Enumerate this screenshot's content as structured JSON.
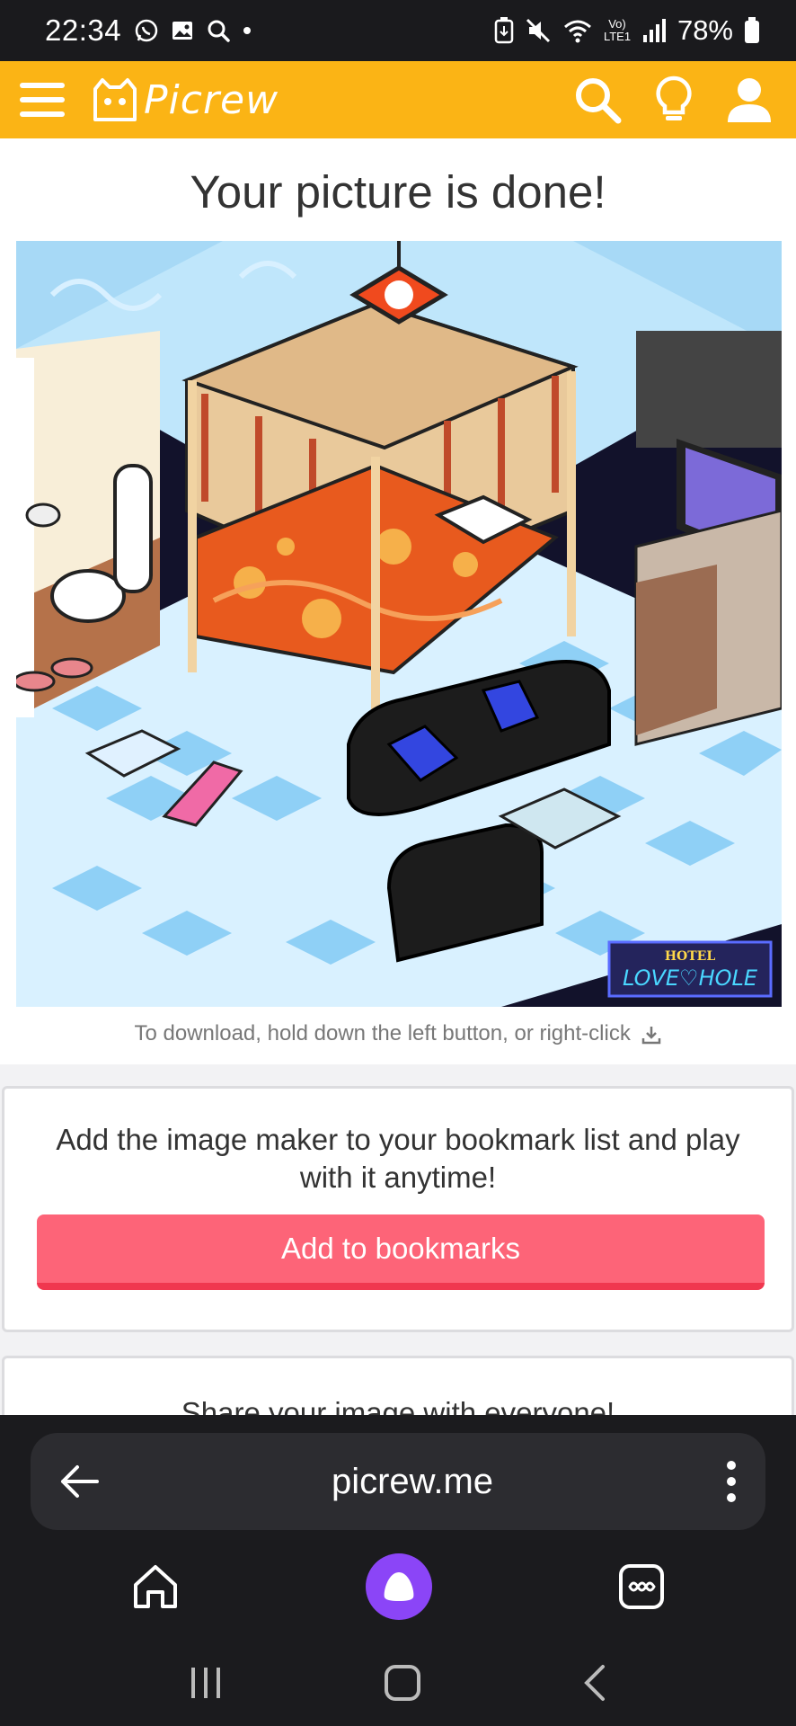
{
  "status_bar": {
    "time": "22:34",
    "battery": "78%",
    "network": "Vo) LTE1",
    "left_icons": [
      "whatsapp-icon",
      "gallery-icon",
      "search-icon",
      "dot-icon"
    ],
    "right_icons": [
      "battery-saver-icon",
      "mute-icon",
      "wifi-icon",
      "signal-icon",
      "battery-icon"
    ]
  },
  "header": {
    "logo_text": "Picrew",
    "menu_icon": "hamburger-icon",
    "actions": [
      "search-icon",
      "lightbulb-icon",
      "user-icon"
    ],
    "accent_color": "#fbb415"
  },
  "main": {
    "title": "Your picture is done!",
    "image_sign": {
      "line1": "HOTEL",
      "line2": "LOVE♡HOLE"
    },
    "download_hint": "To download, hold down the left button, or right-click"
  },
  "bookmark_card": {
    "text": "Add the image maker to your bookmark list and play with it anytime!",
    "button_label": "Add to bookmarks",
    "button_color": "#fd6478"
  },
  "share_card": {
    "text": "Share your image with everyone!"
  },
  "browser": {
    "url": "picrew.me",
    "back_icon": "arrow-left-icon",
    "menu_icon": "kebab-menu-icon",
    "nav": [
      "home-icon",
      "alice-assistant-icon",
      "tabs-icon"
    ],
    "system_nav": [
      "recents-icon",
      "home-square-icon",
      "back-chevron-icon"
    ]
  }
}
